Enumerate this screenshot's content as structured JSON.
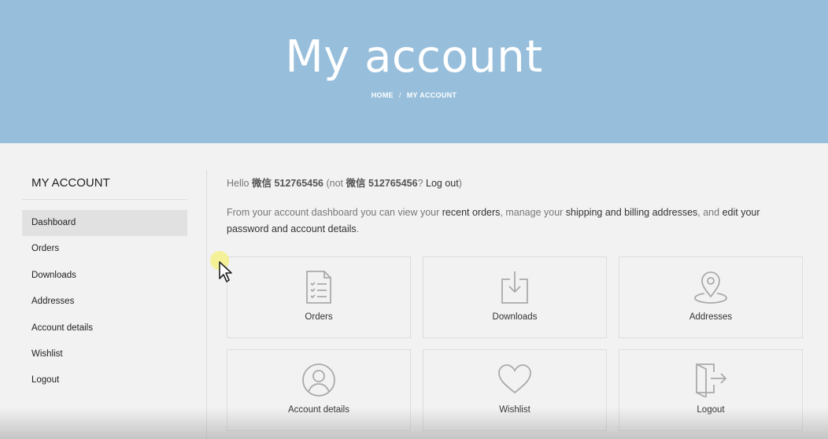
{
  "hero": {
    "title": "My account",
    "breadcrumb": {
      "home": "HOME",
      "separator": "/",
      "current": "MY ACCOUNT"
    },
    "background": "#97bedb"
  },
  "sidebar": {
    "heading": "MY ACCOUNT",
    "items": [
      {
        "label": "Dashboard",
        "active": true
      },
      {
        "label": "Orders"
      },
      {
        "label": "Downloads"
      },
      {
        "label": "Addresses"
      },
      {
        "label": "Account details"
      },
      {
        "label": "Wishlist"
      },
      {
        "label": "Logout"
      }
    ]
  },
  "main": {
    "hello": {
      "prefix": "Hello ",
      "username": "微信 512765456",
      "not_prefix": " (not ",
      "username2": "微信 512765456",
      "question": "? ",
      "logout": "Log out",
      "suffix": ")"
    },
    "intro": {
      "p1": "From your account dashboard you can view your ",
      "link1": "recent orders",
      "p2": ", manage your ",
      "link2": "shipping and billing addresses",
      "p3": ", and ",
      "link3": "edit your password and account details",
      "p4": "."
    },
    "tiles": [
      {
        "label": "Orders",
        "icon": "clipboard-list-icon"
      },
      {
        "label": "Downloads",
        "icon": "download-icon"
      },
      {
        "label": "Addresses",
        "icon": "map-pin-icon"
      },
      {
        "label": "Account details",
        "icon": "user-circle-icon"
      },
      {
        "label": "Wishlist",
        "icon": "heart-icon"
      },
      {
        "label": "Logout",
        "icon": "door-exit-icon"
      }
    ]
  },
  "colors": {
    "accent": "#97bedb",
    "background": "#f2f2f2",
    "icon": "#aaaaaa"
  }
}
